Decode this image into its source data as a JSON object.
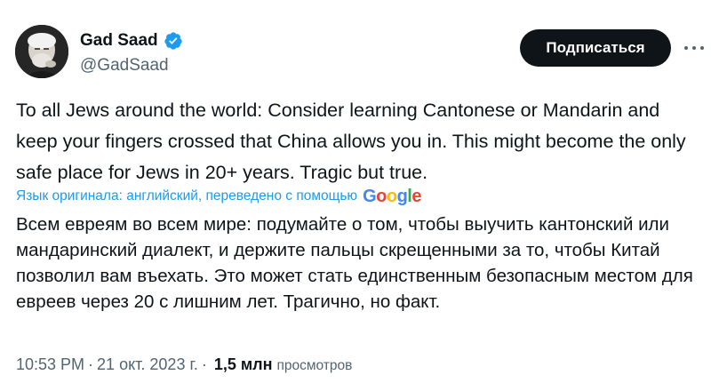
{
  "author": {
    "display_name": "Gad Saad",
    "handle": "@GadSaad",
    "verified_color": "#1d9bf0"
  },
  "actions": {
    "subscribe_label": "Подписаться",
    "more_icon": "more-horizontal-icon"
  },
  "tweet": {
    "text": "To all Jews around the world:  Consider learning Cantonese or Mandarin and keep your fingers crossed that China allows you in.  This might become the only safe place for Jews in 20+ years.  Tragic but true.",
    "translation_note": "Язык оригинала: английский, переведено с помощью",
    "translation_provider": "Google",
    "translated_text": "Всем евреям во всем мире: подумайте о том, чтобы выучить кантонский или мандаринский диалект, и держите пальцы скрещенными за то, чтобы Китай позволил вам въехать. Это может стать единственным безопасным местом для евреев через 20 с лишним лет. Трагично, но факт."
  },
  "meta": {
    "time": "10:53 PM",
    "separator": "·",
    "date": "21 окт. 2023 г.",
    "views_count": "1,5 млн",
    "views_label": "просмотров"
  },
  "colors": {
    "text": "#0f1419",
    "secondary": "#536471",
    "link": "#1d9bf0",
    "button_bg": "#0f1419"
  }
}
